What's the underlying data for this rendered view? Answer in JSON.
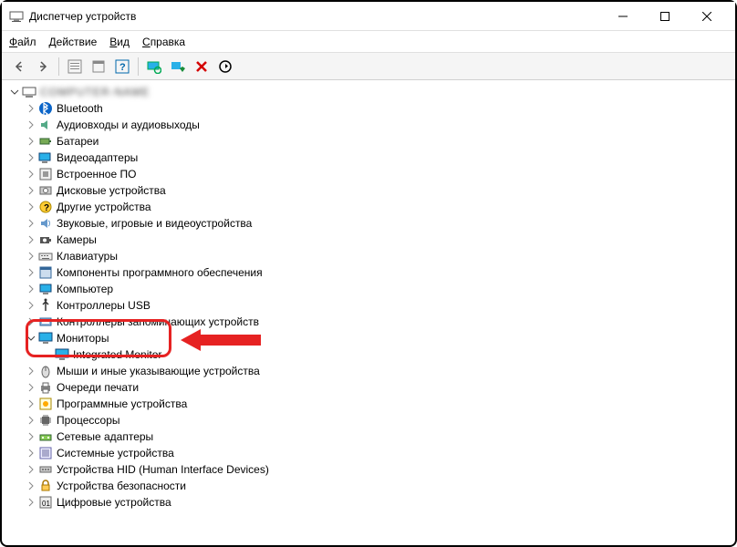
{
  "window": {
    "title": "Диспетчер устройств"
  },
  "menu": {
    "file": "Файл",
    "action": "Действие",
    "view": "Вид",
    "help": "Справка"
  },
  "tree": {
    "root": "COMPUTER-NAME",
    "categories": [
      {
        "icon": "bluetooth",
        "label": "Bluetooth"
      },
      {
        "icon": "audio",
        "label": "Аудиовходы и аудиовыходы"
      },
      {
        "icon": "battery",
        "label": "Батареи"
      },
      {
        "icon": "display-adapter",
        "label": "Видеоадаптеры"
      },
      {
        "icon": "firmware",
        "label": "Встроенное ПО"
      },
      {
        "icon": "disk",
        "label": "Дисковые устройства"
      },
      {
        "icon": "other",
        "label": "Другие устройства"
      },
      {
        "icon": "sound",
        "label": "Звуковые, игровые и видеоустройства"
      },
      {
        "icon": "camera",
        "label": "Камеры"
      },
      {
        "icon": "keyboard",
        "label": "Клавиатуры"
      },
      {
        "icon": "software",
        "label": "Компоненты программного обеспечения"
      },
      {
        "icon": "computer",
        "label": "Компьютер"
      },
      {
        "icon": "usb",
        "label": "Контроллеры USB"
      },
      {
        "icon": "storage-ctrl",
        "label": "Контроллеры запоминающих устройств"
      },
      {
        "icon": "monitor",
        "label": "Мониторы",
        "expanded": true,
        "children": [
          {
            "icon": "monitor",
            "label": "Integrated Monitor"
          }
        ]
      },
      {
        "icon": "mouse",
        "label": "Мыши и иные указывающие устройства"
      },
      {
        "icon": "print",
        "label": "Очереди печати"
      },
      {
        "icon": "software-dev",
        "label": "Программные устройства"
      },
      {
        "icon": "cpu",
        "label": "Процессоры"
      },
      {
        "icon": "network",
        "label": "Сетевые адаптеры"
      },
      {
        "icon": "system",
        "label": "Системные устройства"
      },
      {
        "icon": "hid",
        "label": "Устройства HID (Human Interface Devices)"
      },
      {
        "icon": "security",
        "label": "Устройства безопасности"
      },
      {
        "icon": "digital",
        "label": "Цифровые устройства"
      }
    ]
  }
}
